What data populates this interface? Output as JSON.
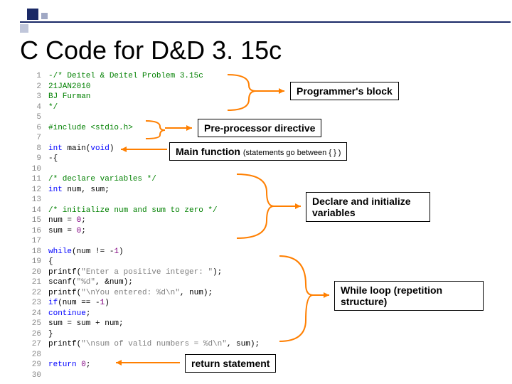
{
  "title": "C Code for D&D 3. 15c",
  "code": [
    {
      "n": "1",
      "t": "-/* Deitel & Deitel Problem 3.15c",
      "c": "green"
    },
    {
      "n": "2",
      "t": "   21JAN2010",
      "c": "green"
    },
    {
      "n": "3",
      "t": "   BJ Furman",
      "c": "green"
    },
    {
      "n": "4",
      "t": "*/",
      "c": "green"
    },
    {
      "n": "5",
      "t": "",
      "c": "black"
    },
    {
      "n": "6",
      "t": "#include <stdio.h>",
      "c": "green"
    },
    {
      "n": "7",
      "t": "",
      "c": "black"
    },
    {
      "n": "8",
      "t": "int main(void)",
      "c": "mixed_main"
    },
    {
      "n": "9",
      "t": "-{",
      "c": "black"
    },
    {
      "n": "10",
      "t": "",
      "c": "black"
    },
    {
      "n": "11",
      "t": "    /* declare variables */",
      "c": "green"
    },
    {
      "n": "12",
      "t": "    int num, sum;",
      "c": "decl"
    },
    {
      "n": "13",
      "t": "",
      "c": "black"
    },
    {
      "n": "14",
      "t": "    /* initialize num and sum to zero */",
      "c": "green"
    },
    {
      "n": "15",
      "t": "    num = 0;",
      "c": "assign"
    },
    {
      "n": "16",
      "t": "    sum = 0;",
      "c": "assign"
    },
    {
      "n": "17",
      "t": "",
      "c": "black"
    },
    {
      "n": "18",
      "t": "    while(num != -1)",
      "c": "while"
    },
    {
      "n": "19",
      "t": "    {",
      "c": "black"
    },
    {
      "n": "20",
      "t": "        printf(\"Enter a positive integer: \");",
      "c": "printf"
    },
    {
      "n": "21",
      "t": "        scanf(\"%d\", &num);",
      "c": "scanf"
    },
    {
      "n": "22",
      "t": "        printf(\"\\nYou entered: %d\\n\", num);",
      "c": "printf"
    },
    {
      "n": "23",
      "t": "        if(num == -1)",
      "c": "if"
    },
    {
      "n": "24",
      "t": "            continue;",
      "c": "continue"
    },
    {
      "n": "25",
      "t": "        sum = sum + num;",
      "c": "black"
    },
    {
      "n": "26",
      "t": "    }",
      "c": "black"
    },
    {
      "n": "27",
      "t": "    printf(\"\\nsum of valid numbers = %d\\n\", sum);",
      "c": "printf"
    },
    {
      "n": "28",
      "t": "",
      "c": "black"
    },
    {
      "n": "29",
      "t": "    return 0;",
      "c": "return"
    },
    {
      "n": "30",
      "t": "",
      "c": "black"
    }
  ],
  "labels": {
    "programmer": "Programmer's block",
    "preprocessor": "Pre-processor directive",
    "main": "Main function",
    "main_sub": "(statements go between { } )",
    "declare": "Declare and initialize variables",
    "while": "While loop (repetition structure)",
    "return": "return statement"
  }
}
